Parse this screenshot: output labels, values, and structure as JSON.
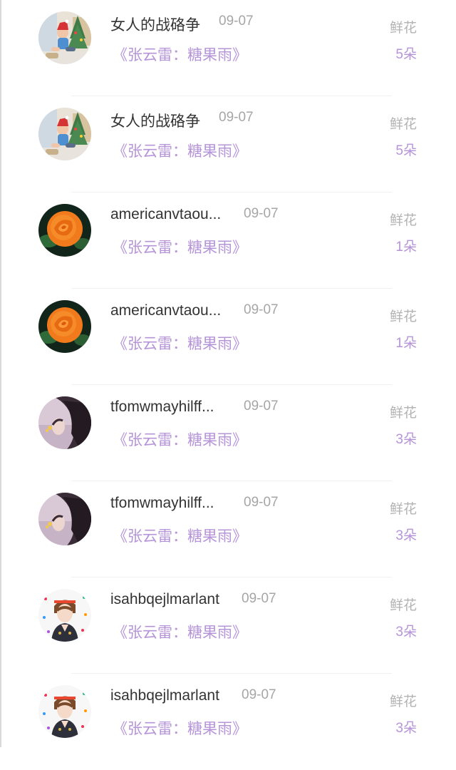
{
  "items": [
    {
      "name": "女人的战硌争",
      "date": "09-07",
      "song": "《张云雷：糖果雨》",
      "gift_label": "鲜花",
      "gift_count": "5朵",
      "avatar": "child-christmas-avatar"
    },
    {
      "name": "女人的战硌争",
      "date": "09-07",
      "song": "《张云雷：糖果雨》",
      "gift_label": "鲜花",
      "gift_count": "5朵",
      "avatar": "child-christmas-avatar"
    },
    {
      "name": "americanvtaou...",
      "date": "09-07",
      "song": "《张云雷：糖果雨》",
      "gift_label": "鲜花",
      "gift_count": "1朵",
      "avatar": "orange-rose-avatar"
    },
    {
      "name": "americanvtaou...",
      "date": "09-07",
      "song": "《张云雷：糖果雨》",
      "gift_label": "鲜花",
      "gift_count": "1朵",
      "avatar": "orange-rose-avatar"
    },
    {
      "name": "tfomwmayhilff...",
      "date": "09-07",
      "song": "《张云雷：糖果雨》",
      "gift_label": "鲜花",
      "gift_count": "3朵",
      "avatar": "long-hair-girl-avatar"
    },
    {
      "name": "tfomwmayhilff...",
      "date": "09-07",
      "song": "《张云雷：糖果雨》",
      "gift_label": "鲜花",
      "gift_count": "3朵",
      "avatar": "long-hair-girl-avatar"
    },
    {
      "name": "isahbqejlmarlant",
      "date": "09-07",
      "song": "《张云雷：糖果雨》",
      "gift_label": "鲜花",
      "gift_count": "3朵",
      "avatar": "anime-boy-avatar"
    },
    {
      "name": "isahbqejlmarlant",
      "date": "09-07",
      "song": "《张云雷：糖果雨》",
      "gift_label": "鲜花",
      "gift_count": "3朵",
      "avatar": "anime-boy-avatar"
    }
  ],
  "colors": {
    "song": "#b594d8",
    "count": "#b594d8",
    "name": "#333333",
    "muted": "#a6a6a6"
  }
}
